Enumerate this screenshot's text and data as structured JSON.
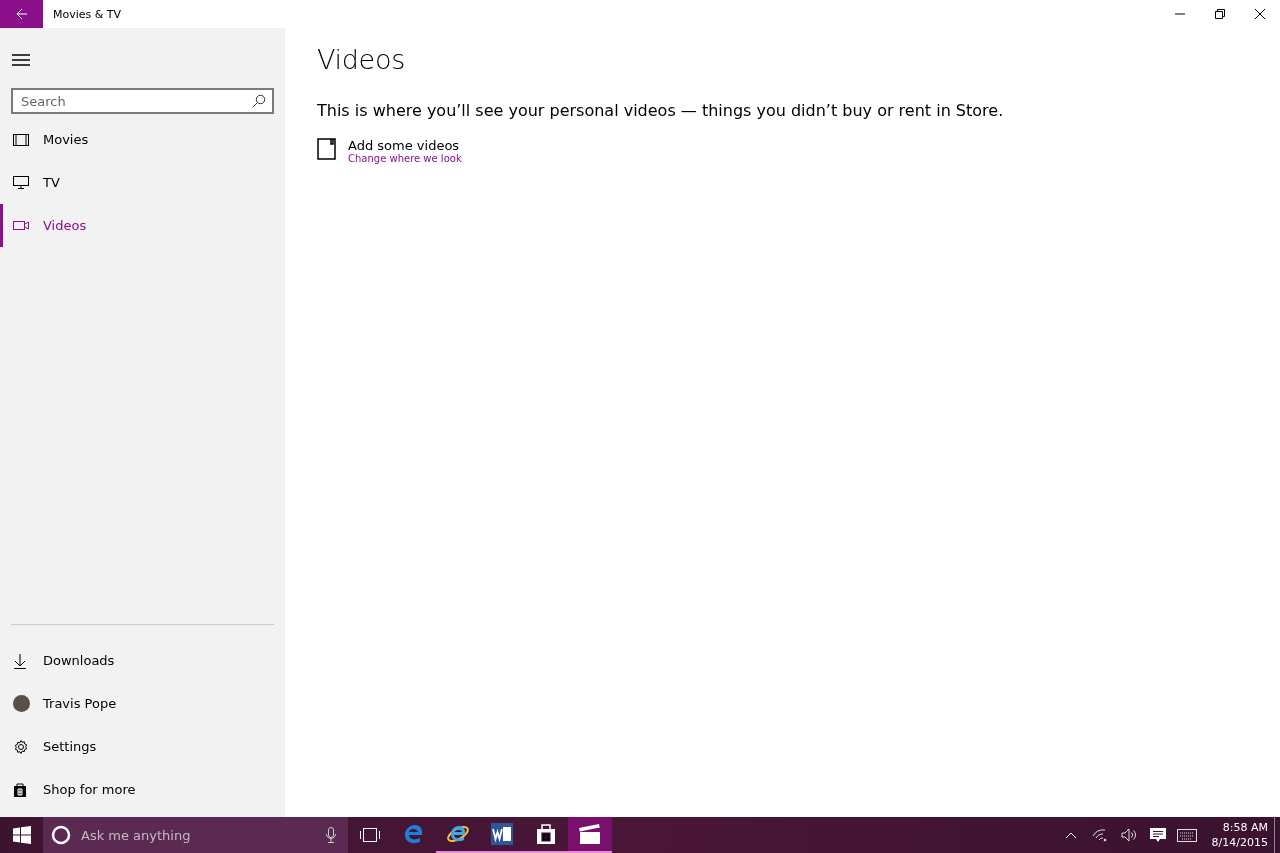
{
  "window": {
    "title": "Movies & TV"
  },
  "sidebar": {
    "search": {
      "placeholder": "Search"
    },
    "items": [
      {
        "kind": "movies",
        "label": "Movies",
        "selected": false
      },
      {
        "kind": "tv",
        "label": "TV",
        "selected": false
      },
      {
        "kind": "videos",
        "label": "Videos",
        "selected": true
      }
    ],
    "bottom_items": [
      {
        "kind": "downloads",
        "label": "Downloads"
      },
      {
        "kind": "account",
        "label": "Travis Pope"
      },
      {
        "kind": "settings",
        "label": "Settings"
      },
      {
        "kind": "store",
        "label": "Shop for more"
      }
    ]
  },
  "content": {
    "heading": "Videos",
    "description": "This is where you’ll see your personal videos — things you didn’t buy or rent in Store.",
    "add_action": {
      "label": "Add some videos",
      "link": "Change where we look"
    }
  },
  "taskbar": {
    "search": {
      "placeholder": "Ask me anything"
    },
    "apps": [
      {
        "kind": "edge",
        "running": false,
        "selected": false
      },
      {
        "kind": "ie",
        "running": true,
        "selected": false
      },
      {
        "kind": "word",
        "running": true,
        "selected": false
      },
      {
        "kind": "store",
        "running": true,
        "selected": false
      },
      {
        "kind": "movies",
        "running": true,
        "selected": true
      }
    ],
    "time": "8:58 AM",
    "date": "8/14/2015"
  }
}
